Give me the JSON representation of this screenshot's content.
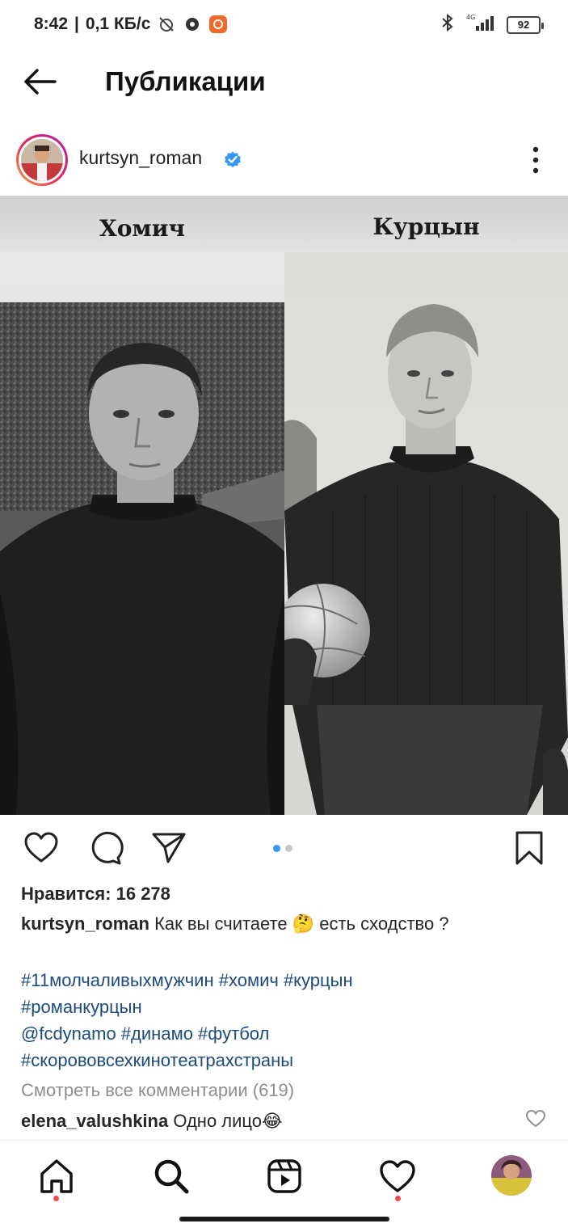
{
  "status_bar": {
    "time": "8:42",
    "separator": "|",
    "speed": "0,1 КБ/с",
    "battery": "92"
  },
  "header": {
    "title": "Публикации",
    "back_icon": "arrow-left-icon"
  },
  "post": {
    "username": "kurtsyn_roman",
    "verified": true,
    "image": {
      "left_name": "Хомич",
      "right_name": "Курцын",
      "carousel_count": 2,
      "carousel_active": 1
    },
    "likes": "Нравится: 16 278",
    "caption": {
      "user": "kurtsyn_roman",
      "text": "Как вы считаете 🤔 есть сходство ?"
    },
    "hashtags": [
      "#11молчаливыхмужчин #хомич #курцын",
      "#романкурцын",
      "@fcdynamo #динамо #футбол",
      "#скорововсехкинотеатрахстраны"
    ],
    "view_comments": "Смотреть все комментарии (619)",
    "comment": {
      "user": "elena_valushkina",
      "text": "Одно лицо😂"
    }
  },
  "actions": {
    "icons": [
      "heart-icon",
      "comment-icon",
      "share-icon",
      "bookmark-icon"
    ]
  },
  "bottom_nav": {
    "items": [
      "home-icon",
      "search-icon",
      "reels-icon",
      "activity-heart-icon",
      "profile-avatar"
    ]
  },
  "colors": {
    "accent": "#3897f0",
    "hashtag": "#1c4b7d",
    "notification": "#ed4956",
    "muted": "#8e8e8e"
  }
}
